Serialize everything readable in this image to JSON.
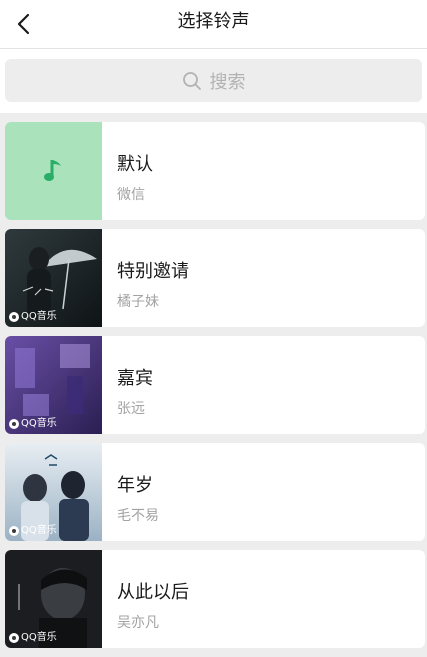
{
  "header": {
    "title": "选择铃声"
  },
  "search": {
    "placeholder": "搜索"
  },
  "ringtones": [
    {
      "title": "默认",
      "artist": "微信",
      "cover": "music-note-icon",
      "badge": ""
    },
    {
      "title": "特别邀请",
      "artist": "橘子妹",
      "cover": "album-cover",
      "badge": "QQ音乐"
    },
    {
      "title": "嘉宾",
      "artist": "张远",
      "cover": "album-cover",
      "badge": "QQ音乐"
    },
    {
      "title": "年岁",
      "artist": "毛不易",
      "cover": "album-cover",
      "badge": "QQ音乐"
    },
    {
      "title": "从此以后",
      "artist": "吴亦凡",
      "cover": "album-cover",
      "badge": "QQ音乐"
    }
  ],
  "colors": {
    "default_cover_bg": "#a9e2bb",
    "music_note": "#2aae67",
    "background": "#ededed",
    "card": "#ffffff"
  }
}
